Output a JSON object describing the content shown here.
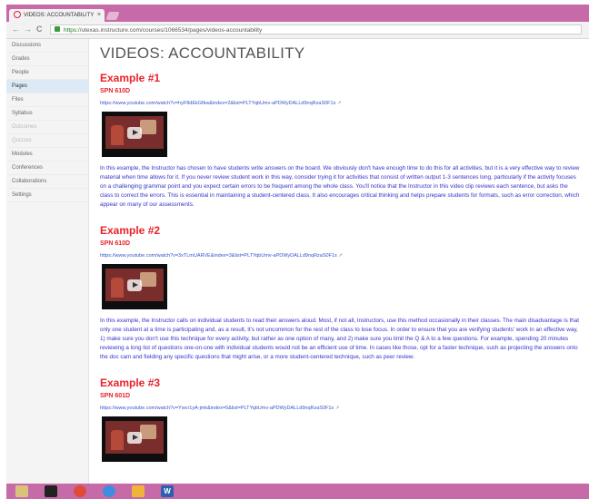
{
  "browser": {
    "tab_title": "VIDEOS: ACCOUNTABILITY",
    "tab_close": "×",
    "url_scheme": "https://",
    "url_rest": "utexas.instructure.com/courses/1066534/pages/videos-accountability",
    "back": "←",
    "forward": "→",
    "reload": "C"
  },
  "sidebar": {
    "items": [
      {
        "label": "Discussions",
        "state": "normal"
      },
      {
        "label": "Grades",
        "state": "normal"
      },
      {
        "label": "People",
        "state": "normal"
      },
      {
        "label": "Pages",
        "state": "active"
      },
      {
        "label": "Files",
        "state": "normal"
      },
      {
        "label": "Syllabus",
        "state": "normal"
      },
      {
        "label": "Outcomes",
        "state": "dim"
      },
      {
        "label": "Quizzes",
        "state": "dim"
      },
      {
        "label": "Modules",
        "state": "normal"
      },
      {
        "label": "Conferences",
        "state": "normal"
      },
      {
        "label": "Collaborations",
        "state": "normal"
      },
      {
        "label": "Settings",
        "state": "normal"
      }
    ]
  },
  "page": {
    "title": "VIDEOS: ACCOUNTABILITY",
    "examples": [
      {
        "heading": "Example #1",
        "code": "SPN 610D",
        "link": "https://www.youtube.com/watch?v=hyF8dEkGfkw&index=2&list=PLTYqbUmv-aPDWyDALLd9nqRzaS0F1s",
        "description": "In this example, the Instructor has chosen to have students write answers on the board. We obviously don't have enough time to do this for all activities, but it is a very effective way to review material when time allows for it. If you never review student work in this way, consider trying it for activities that consist of written output 1-3 sentences long, particularly if the activity focuses on a challenging grammar point and you expect certain errors to be frequent among the whole class. You'll notice that the Instructor in this video clip reviews each sentence, but asks the class to correct the errors. This is essential in maintaining a student-centered class. It also encourages critical thinking and helps prepare students for formats, such as error correction, which appear on many of our assessments."
      },
      {
        "heading": "Example #2",
        "code": "SPN 610D",
        "link": "https://www.youtube.com/watch?v=3xTLmUARVE&index=3&list=PLTYqbUmv-aPDWyDALLd9nqRzaS0F1s",
        "description": "In this example, the Instructor calls on individual students to read their answers aloud. Most, if not all, Instructors, use this method occasionally in their classes. The main disadvantage is that only one student at a time is participating and, as a result, it's not uncommon for the rest of the class to lose focus. In order to ensure that you are verifying students' work in an effective way, 1) make sure you don't use this technique for every activity, but rather as one option of many, and 2) make sure you limit the Q & A to a few questions. For example, spending 20 minutes reviewing a long list of questions one-on-one with individual students would not be an efficient use of time. In cases like those, opt for a faster technique, such as projecting the answers onto the doc cam and fielding any specific questions that might arise, or a more student-centered technique, such as peer review."
      },
      {
        "heading": "Example #3",
        "code": "SPN 601D",
        "link": "https://www.youtube.com/watch?v=Ywcr1yA-jmk&index=5&list=PLTYqbUmv-aPDWyDALLd9nqRzaS0F1s",
        "description": ""
      }
    ]
  },
  "taskbar": {
    "icons": [
      "file-explorer-icon",
      "media-icon",
      "chrome-icon",
      "internet-explorer-icon",
      "folder-icon",
      "word-icon"
    ],
    "word_letter": "W"
  },
  "colors": {
    "accent_pink": "#c76aa8",
    "heading_red": "#e8232a",
    "body_blue": "#3333cc",
    "link_blue": "#3355cc"
  }
}
